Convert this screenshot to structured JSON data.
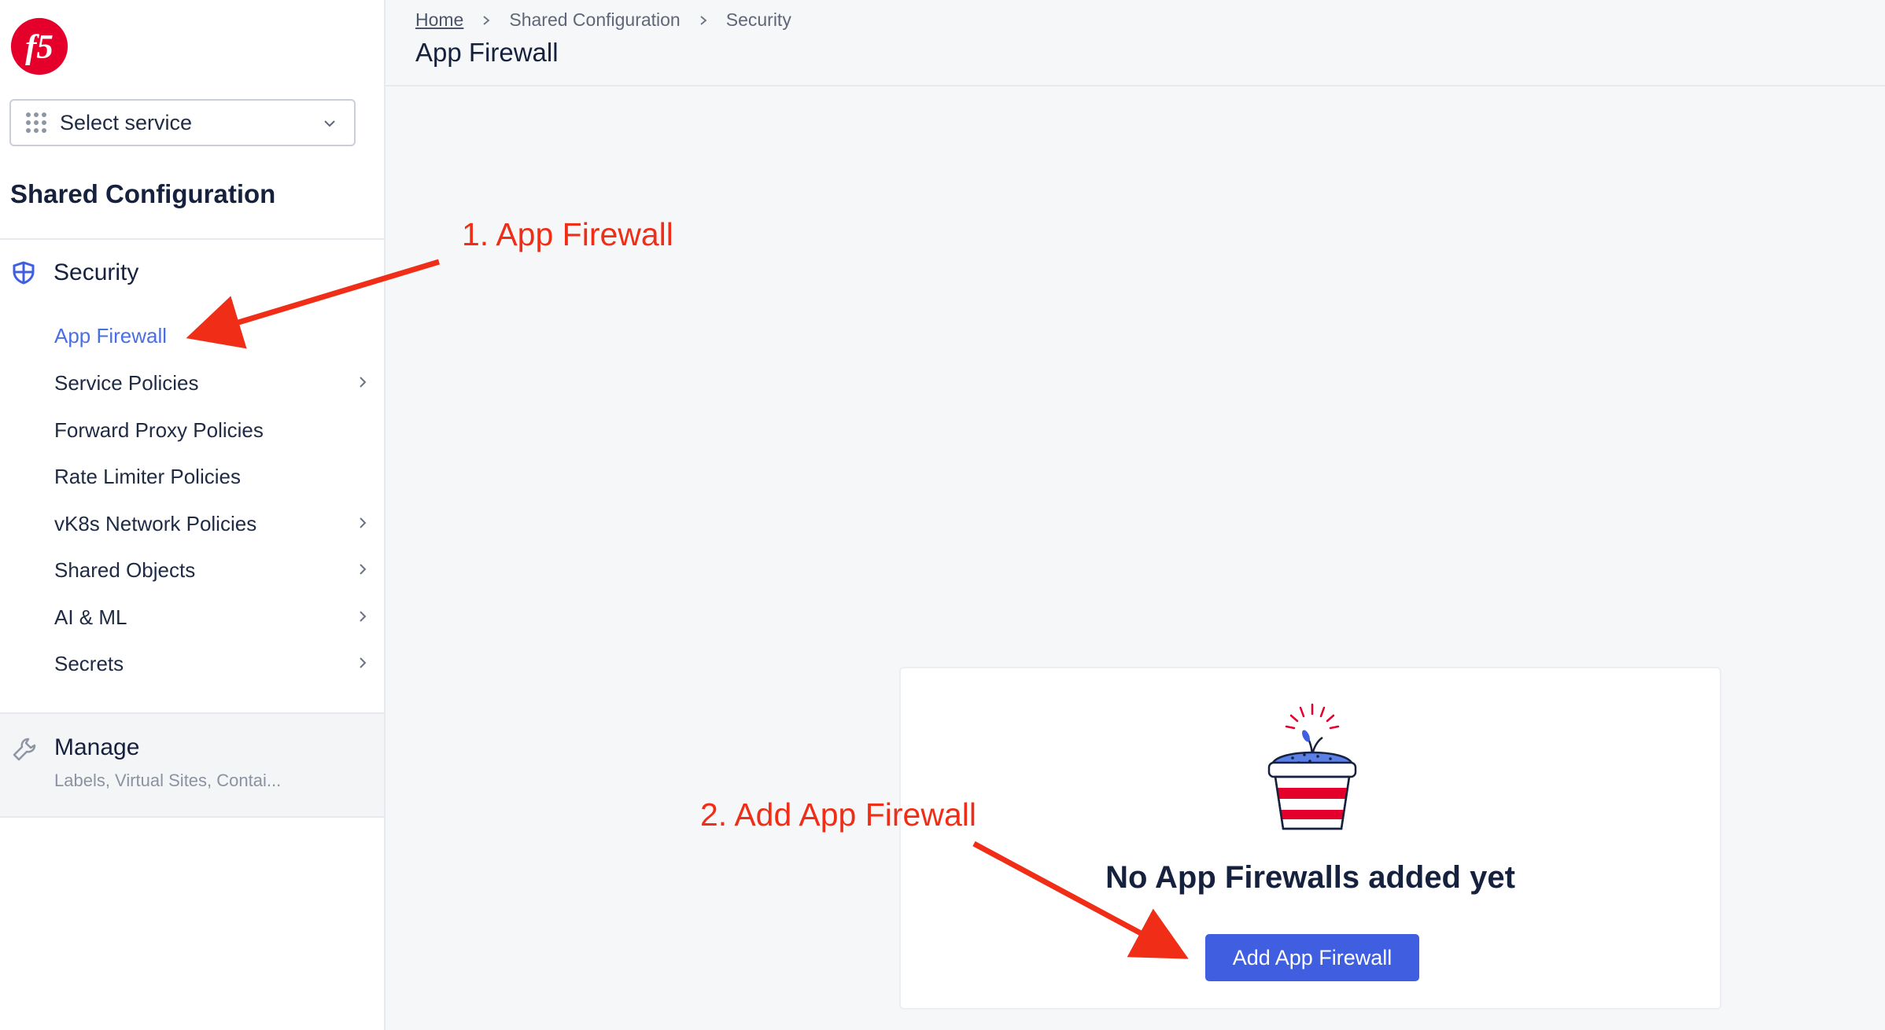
{
  "sidebar": {
    "logo": "f5",
    "select_service": {
      "label": "Select service",
      "icon": "grid-dots-icon"
    },
    "section_title": "Shared Configuration",
    "security": {
      "label": "Security",
      "icon": "shield-icon",
      "items": [
        {
          "label": "App Firewall",
          "active": true,
          "has_children": false
        },
        {
          "label": "Service Policies",
          "active": false,
          "has_children": true
        },
        {
          "label": "Forward Proxy Policies",
          "active": false,
          "has_children": false
        },
        {
          "label": "Rate Limiter Policies",
          "active": false,
          "has_children": false
        },
        {
          "label": "vK8s Network Policies",
          "active": false,
          "has_children": true
        },
        {
          "label": "Shared Objects",
          "active": false,
          "has_children": true
        },
        {
          "label": "AI & ML",
          "active": false,
          "has_children": true
        },
        {
          "label": "Secrets",
          "active": false,
          "has_children": true
        }
      ]
    },
    "manage": {
      "label": "Manage",
      "icon": "wrench-icon",
      "subtitle": "Labels, Virtual Sites, Contai..."
    }
  },
  "header": {
    "breadcrumb": [
      "Home",
      "Shared Configuration",
      "Security"
    ],
    "title": "App Firewall"
  },
  "empty_state": {
    "icon": "plant-pot-icon",
    "title": "No App Firewalls added yet",
    "button_label": "Add App Firewall"
  },
  "annotations": {
    "step1": "1. App Firewall",
    "step2": "2. Add App Firewall"
  },
  "colors": {
    "accent": "#3f5fe0",
    "active_link": "#4a6fe3",
    "annotation": "#f02e17",
    "logo": "#e4002b"
  }
}
